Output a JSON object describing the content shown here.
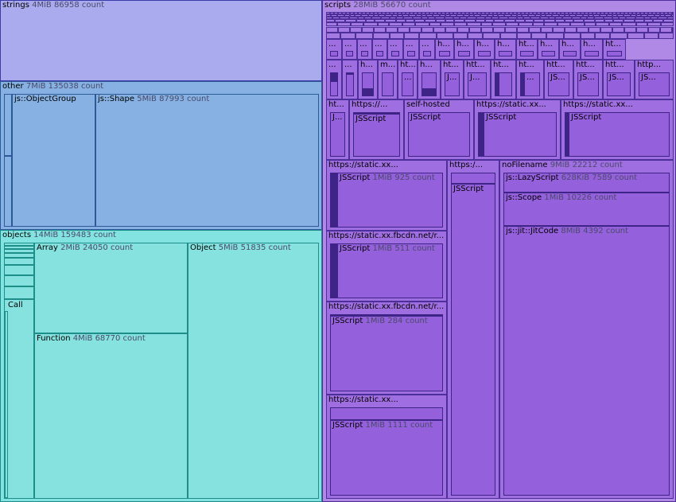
{
  "treemap": {
    "strings": {
      "name": "strings",
      "size": "4MiB",
      "count": "86958 count"
    },
    "other": {
      "name": "other",
      "size": "7MiB",
      "count": "135038 count",
      "children": [
        {
          "name": "js::ObjectGroup",
          "size": "",
          "count": ""
        },
        {
          "name": "js::Shape",
          "size": "5MiB",
          "count": "87993 count"
        }
      ]
    },
    "objects": {
      "name": "objects",
      "size": "14MiB",
      "count": "159483 count",
      "children": [
        {
          "name": "Call"
        },
        {
          "name": "Array",
          "size": "2MiB",
          "count": "24050 count"
        },
        {
          "name": "Function",
          "size": "4MiB",
          "count": "68770 count"
        },
        {
          "name": "Object",
          "size": "5MiB",
          "count": "51835 count"
        }
      ]
    },
    "scripts": {
      "name": "scripts",
      "size": "28MiB",
      "count": "56670 count",
      "row3": [
        "...",
        "...",
        "...",
        "...",
        "...",
        "...",
        "...",
        "h...",
        "h...",
        "h...",
        "h...",
        "ht...",
        "h...",
        "h...",
        "h...",
        "ht..."
      ],
      "row4": [
        "...",
        "...",
        "h...",
        "m...",
        "ht...",
        "h...",
        "ht...",
        "htt...",
        "ht...",
        "ht...",
        "htt...",
        "htt...",
        "htt...",
        "http..."
      ],
      "row4_js": [
        "...",
        "...",
        "J...",
        "J...",
        "...",
        "JS...",
        "JS...",
        "JS...",
        "JS..."
      ],
      "row5": [
        "ht...",
        "https://...",
        "self-hosted",
        "https://static.xx...",
        "https://static.xx..."
      ],
      "row5_js": [
        "J...",
        "JSScript",
        "JSScript",
        "JSScript",
        "JSScript"
      ],
      "left_col": [
        {
          "name": "https://static.xx...",
          "js": "JSScript",
          "size": "1MiB",
          "count": "925 count"
        },
        {
          "name": "https://static.xx.fbcdn.net/r...",
          "js": "JSScript",
          "size": "1MiB",
          "count": "511 count"
        },
        {
          "name": "https://static.xx.fbcdn.net/r...",
          "js": "JSScript",
          "size": "1MiB",
          "count": "284 count"
        },
        {
          "name": "https://static.xx...",
          "js": "JSScript",
          "size": "1MiB",
          "count": "1111 count"
        }
      ],
      "mid_col": {
        "name": "https:/...",
        "js": "JSScript"
      },
      "nofilename": {
        "name": "noFilename",
        "size": "9MiB",
        "count": "22212 count",
        "children": [
          {
            "name": "js::LazyScript",
            "size": "628KiB",
            "count": "7589 count"
          },
          {
            "name": "js::Scope",
            "size": "1MiB",
            "count": "10226 count"
          },
          {
            "name": "js::jit::JitCode",
            "size": "8MiB",
            "count": "4392 count"
          }
        ]
      }
    }
  }
}
